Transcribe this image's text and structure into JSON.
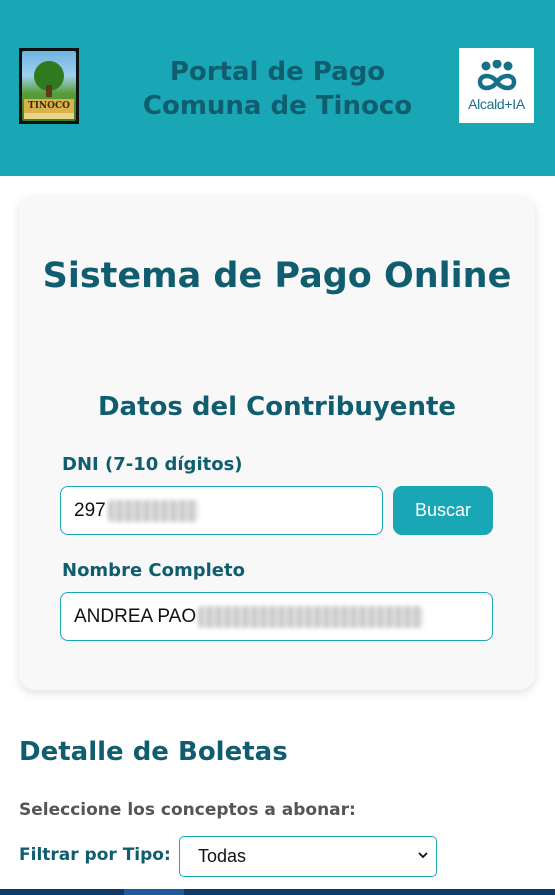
{
  "header": {
    "title_line1": "Portal de Pago",
    "title_line2": "Comuna de Tinoco",
    "left_logo_text": "TINOCO",
    "right_logo_text": "Alcald+IA"
  },
  "form": {
    "title": "Sistema de Pago Online",
    "section_title": "Datos del Contribuyente",
    "dni_label": "DNI (7-10 dígitos)",
    "dni_value": "297",
    "search_button": "Buscar",
    "name_label": "Nombre Completo",
    "name_value": "ANDREA PAO"
  },
  "boletas": {
    "title": "Detalle de Boletas",
    "instructions": "Seleccione los conceptos a abonar:",
    "filter_label": "Filtrar por Tipo:",
    "filter_selected": "Todas"
  },
  "colors": {
    "header_bg": "#19a7b6",
    "primary_text": "#0f5d6e",
    "accent": "#19a7b6"
  }
}
